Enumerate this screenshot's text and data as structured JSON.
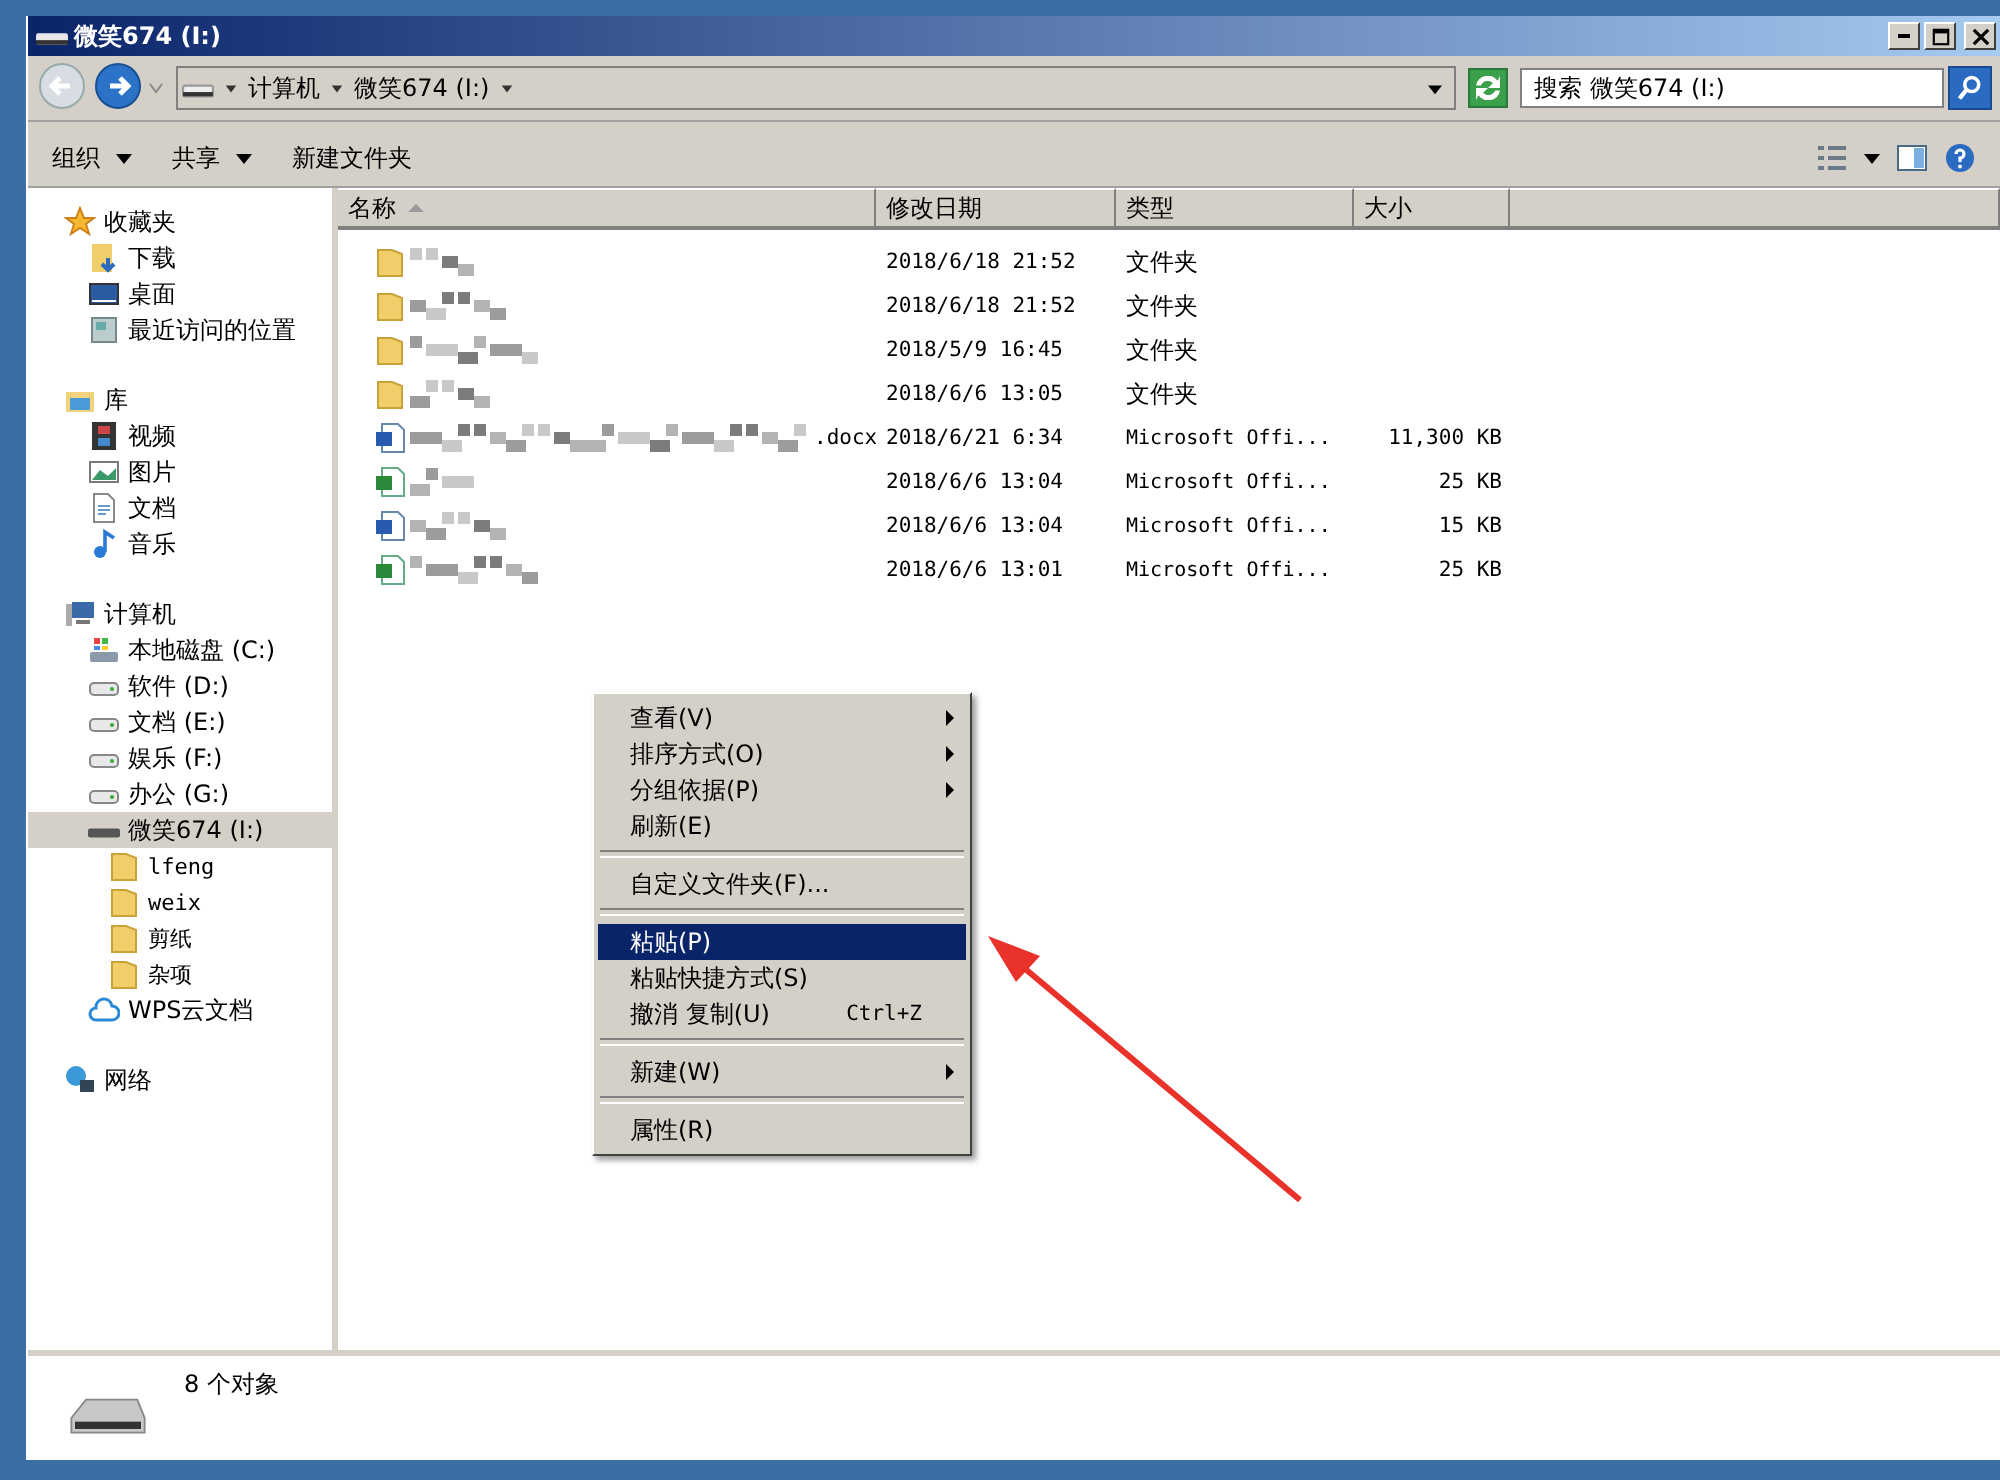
{
  "window": {
    "title": "微笑674 (I:)"
  },
  "address": {
    "crumbs": [
      "计算机",
      "微笑674 (I:)"
    ]
  },
  "search": {
    "placeholder": "搜索 微笑674 (I:)"
  },
  "toolbar": {
    "buttons": [
      {
        "label": "组织",
        "dropdown": true
      },
      {
        "label": "共享",
        "dropdown": true
      },
      {
        "label": "新建文件夹",
        "dropdown": false
      }
    ]
  },
  "sidebar": {
    "groups": [
      {
        "label": "收藏夹",
        "selected": false,
        "children": [
          {
            "label": "下载",
            "selected": false
          },
          {
            "label": "桌面",
            "selected": false
          },
          {
            "label": "最近访问的位置",
            "selected": false
          }
        ]
      },
      {
        "label": "库",
        "selected": false,
        "children": [
          {
            "label": "视频",
            "selected": false
          },
          {
            "label": "图片",
            "selected": false
          },
          {
            "label": "文档",
            "selected": false
          },
          {
            "label": "音乐",
            "selected": false
          }
        ]
      },
      {
        "label": "计算机",
        "selected": false,
        "children": [
          {
            "label": "本地磁盘 (C:)",
            "selected": false
          },
          {
            "label": "软件 (D:)",
            "selected": false
          },
          {
            "label": "文档 (E:)",
            "selected": false
          },
          {
            "label": "娱乐 (F:)",
            "selected": false
          },
          {
            "label": "办公 (G:)",
            "selected": false
          },
          {
            "label": "微笑674 (I:)",
            "selected": true,
            "children": [
              {
                "label": "lfeng",
                "selected": false
              },
              {
                "label": "weix",
                "selected": false
              },
              {
                "label": "剪纸",
                "selected": false
              },
              {
                "label": "杂项",
                "selected": false
              }
            ]
          },
          {
            "label": "WPS云文档",
            "selected": false
          }
        ]
      },
      {
        "label": "网络",
        "selected": false
      }
    ]
  },
  "table": {
    "columns": [
      "名称",
      "修改日期",
      "类型",
      "大小"
    ],
    "rows": [
      {
        "kind": "folder",
        "date": "2018/6/18 21:52",
        "type": "文件夹"
      },
      {
        "kind": "folder",
        "date": "2018/6/18 21:52",
        "type": "文件夹"
      },
      {
        "kind": "folder",
        "date": "2018/5/9 16:45",
        "type": "文件夹"
      },
      {
        "kind": "folder",
        "date": "2018/6/6 13:05",
        "type": "文件夹"
      },
      {
        "kind": "word",
        "name_suffix": ".docx",
        "date": "2018/6/21 6:34",
        "type": "Microsoft Offi...",
        "size": "11,300 KB"
      },
      {
        "kind": "excel",
        "date": "2018/6/6 13:04",
        "type": "Microsoft Offi...",
        "size": "25 KB"
      },
      {
        "kind": "word",
        "date": "2018/6/6 13:04",
        "type": "Microsoft Offi...",
        "size": "15 KB"
      },
      {
        "kind": "excel",
        "date": "2018/6/6 13:01",
        "type": "Microsoft Offi...",
        "size": "25 KB"
      }
    ]
  },
  "context_menu": {
    "groups": [
      [
        {
          "label": "查看(V)",
          "submenu": true,
          "selected": false
        },
        {
          "label": "排序方式(O)",
          "submenu": true,
          "selected": false
        },
        {
          "label": "分组依据(P)",
          "submenu": true,
          "selected": false
        },
        {
          "label": "刷新(E)",
          "submenu": false,
          "selected": false
        }
      ],
      [
        {
          "label": "自定义文件夹(F)...",
          "submenu": false,
          "selected": false
        }
      ],
      [
        {
          "label": "粘贴(P)",
          "submenu": false,
          "selected": true
        },
        {
          "label": "粘贴快捷方式(S)",
          "submenu": false,
          "selected": false
        },
        {
          "label": "撤消 复制(U)",
          "submenu": false,
          "selected": false,
          "shortcut": "Ctrl+Z"
        }
      ],
      [
        {
          "label": "新建(W)",
          "submenu": true,
          "selected": false
        }
      ],
      [
        {
          "label": "属性(R)",
          "submenu": false,
          "selected": false
        }
      ]
    ]
  },
  "status_bar": {
    "text": "8 个对象"
  }
}
